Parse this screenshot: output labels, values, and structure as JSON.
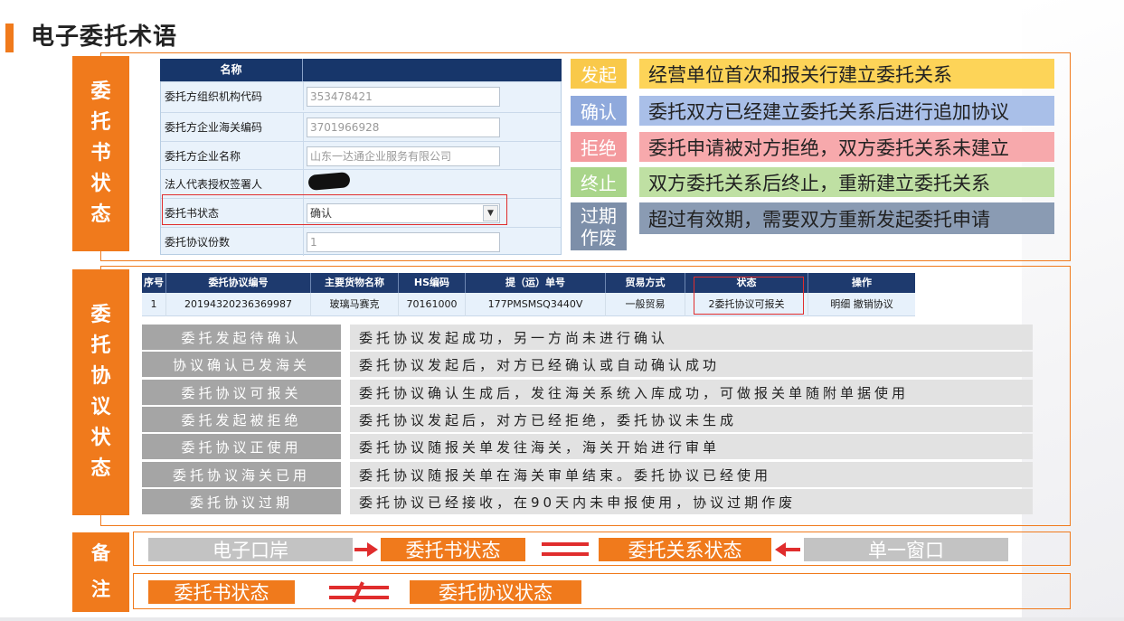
{
  "title": "电子委托术语",
  "sections": {
    "s1": [
      "委",
      "托",
      "书",
      "状",
      "态"
    ],
    "s2": [
      "委",
      "托",
      "协",
      "议",
      "状",
      "态"
    ],
    "s3": [
      "备",
      "注"
    ]
  },
  "form": {
    "header": "名称",
    "rows": [
      {
        "label": "委托方组织机构代码",
        "value": "353478421"
      },
      {
        "label": "委托方企业海关编码",
        "value": "3701966928"
      },
      {
        "label": "委托方企业名称",
        "value": "山东一达通企业服务有限公司"
      },
      {
        "label": "法人代表授权签署人",
        "value": ""
      },
      {
        "label": "委托书状态",
        "value": "确认"
      },
      {
        "label": "委托协议份数",
        "value": "1"
      }
    ]
  },
  "terms": [
    {
      "tag": "发起",
      "desc": "经营单位首次和报关行建立委托关系",
      "tag_color": "#f9c94a",
      "desc_color": "#fdd458"
    },
    {
      "tag": "确认",
      "desc": "委托双方已经建立委托关系后进行追加协议",
      "tag_color": "#8fa9dc",
      "desc_color": "#a9bfe8"
    },
    {
      "tag": "拒绝",
      "desc": "委托申请被对方拒绝，双方委托关系未建立",
      "tag_color": "#f49a9e",
      "desc_color": "#f7a9ac"
    },
    {
      "tag": "终止",
      "desc": "双方委托关系后终止，重新建立委托关系",
      "tag_color": "#a9d58a",
      "desc_color": "#bfe0a3"
    },
    {
      "tag": "过期作废",
      "desc": "超过有效期，需要双方重新发起委托申请",
      "tag_color": "#7d8fa9",
      "desc_color": "#8a9bb3"
    }
  ],
  "table": {
    "headers": [
      "序号",
      "委托协议编号",
      "主要货物名称",
      "HS编码",
      "提（运）单号",
      "贸易方式",
      "状态",
      "操作"
    ],
    "row": [
      "1",
      "20194320236369987",
      "玻璃马赛克",
      "70161000",
      "177PMSMSQ3440V",
      "一般贸易",
      "2委托协议可报关",
      "明细 撤销协议"
    ]
  },
  "agreement_states": [
    {
      "tag": "委托发起待确认",
      "desc": "委托协议发起成功，另一方尚未进行确认"
    },
    {
      "tag": "协议确认已发海关",
      "desc": "委托协议发起后，对方已经确认或自动确认成功"
    },
    {
      "tag": "委托协议可报关",
      "desc": "委托协议确认生成后，发往海关系统入库成功，可做报关单随附单据使用"
    },
    {
      "tag": "委托发起被拒绝",
      "desc": "委托协议发起后，对方已经拒绝，委托协议未生成"
    },
    {
      "tag": "委托协议正使用",
      "desc": "委托协议随报关单发往海关，海关开始进行审单"
    },
    {
      "tag": "委托协议海关已用",
      "desc": "委托协议随报关单在海关审单结束。委托协议已经使用"
    },
    {
      "tag": "委托协议过期",
      "desc": "委托协议已经接收，在90天内未申报使用，协议过期作废"
    }
  ],
  "remarks": {
    "row1": [
      "电子口岸",
      "委托书状态",
      "委托关系状态",
      "单一窗口"
    ],
    "row2": [
      "委托书状态",
      "委托协议状态"
    ]
  },
  "colors": {
    "accent": "#f07a1c",
    "alert": "#e02d2d",
    "table_header": "#1e3a6e"
  }
}
